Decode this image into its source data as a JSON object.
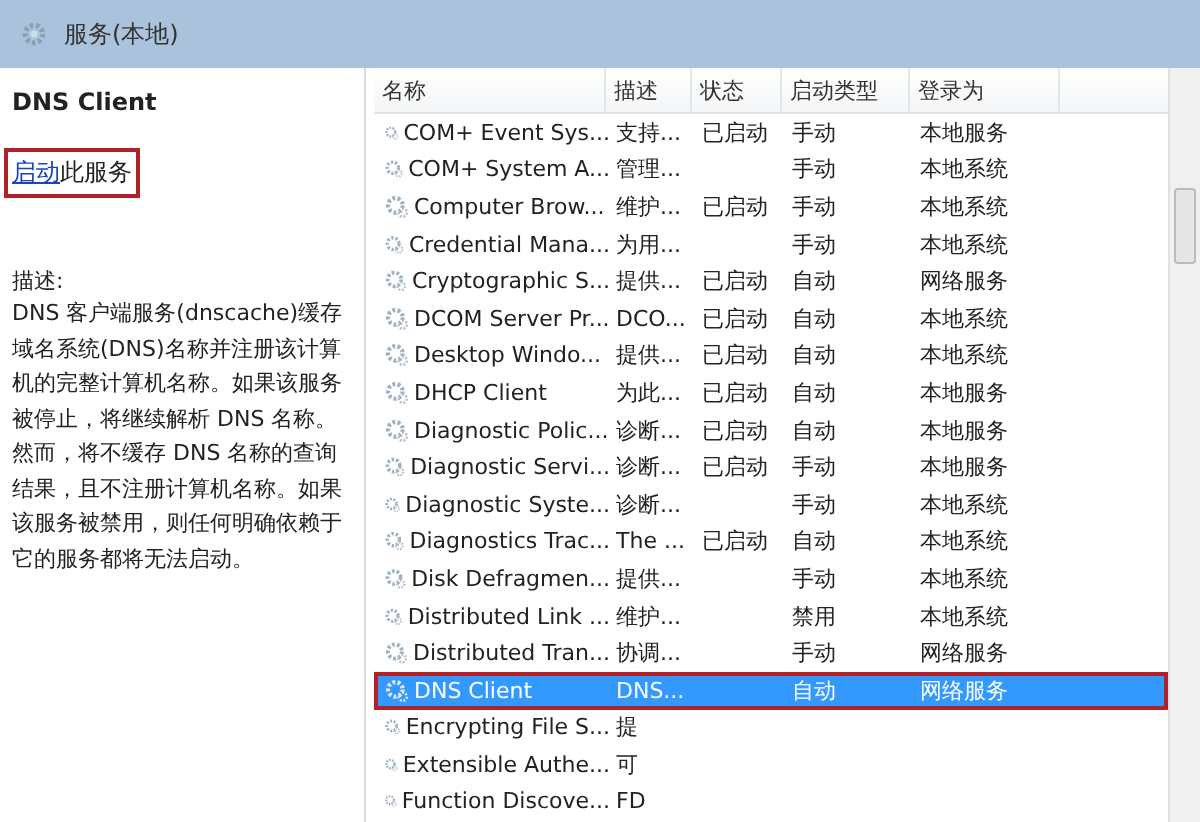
{
  "window": {
    "title": "服务(本地)"
  },
  "detail": {
    "service_name": "DNS Client",
    "action_link": "启动",
    "action_rest": "此服务",
    "action_outlined": true,
    "description_label": "描述:",
    "description": "DNS 客户端服务(dnscache)缓存域名系统(DNS)名称并注册该计算机的完整计算机名称。如果该服务被停止，将继续解析 DNS 名称。然而，将不缓存 DNS 名称的查询结果，且不注册计算机名称。如果该服务被禁用，则任何明确依赖于它的服务都将无法启动。"
  },
  "table": {
    "columns": [
      "名称",
      "描述",
      "状态",
      "启动类型",
      "登录为"
    ],
    "rows": [
      {
        "name": "COM+ Event Sys...",
        "description": "支持...",
        "status": "已启动",
        "startup": "手动",
        "logon": "本地服务",
        "selected": false,
        "outlined": false
      },
      {
        "name": "COM+ System A...",
        "description": "管理...",
        "status": "",
        "startup": "手动",
        "logon": "本地系统",
        "selected": false,
        "outlined": false
      },
      {
        "name": "Computer Brow...",
        "description": "维护...",
        "status": "已启动",
        "startup": "手动",
        "logon": "本地系统",
        "selected": false,
        "outlined": false
      },
      {
        "name": "Credential Mana...",
        "description": "为用...",
        "status": "",
        "startup": "手动",
        "logon": "本地系统",
        "selected": false,
        "outlined": false
      },
      {
        "name": "Cryptographic S...",
        "description": "提供...",
        "status": "已启动",
        "startup": "自动",
        "logon": "网络服务",
        "selected": false,
        "outlined": false
      },
      {
        "name": "DCOM Server Pr...",
        "description": "DCO...",
        "status": "已启动",
        "startup": "自动",
        "logon": "本地系统",
        "selected": false,
        "outlined": false
      },
      {
        "name": "Desktop Windo...",
        "description": "提供...",
        "status": "已启动",
        "startup": "自动",
        "logon": "本地系统",
        "selected": false,
        "outlined": false
      },
      {
        "name": "DHCP Client",
        "description": "为此...",
        "status": "已启动",
        "startup": "自动",
        "logon": "本地服务",
        "selected": false,
        "outlined": false
      },
      {
        "name": "Diagnostic Polic...",
        "description": "诊断...",
        "status": "已启动",
        "startup": "自动",
        "logon": "本地服务",
        "selected": false,
        "outlined": false
      },
      {
        "name": "Diagnostic Servi...",
        "description": "诊断...",
        "status": "已启动",
        "startup": "手动",
        "logon": "本地服务",
        "selected": false,
        "outlined": false
      },
      {
        "name": "Diagnostic Syste...",
        "description": "诊断...",
        "status": "",
        "startup": "手动",
        "logon": "本地系统",
        "selected": false,
        "outlined": false
      },
      {
        "name": "Diagnostics Trac...",
        "description": "The ...",
        "status": "已启动",
        "startup": "自动",
        "logon": "本地系统",
        "selected": false,
        "outlined": false
      },
      {
        "name": "Disk Defragmen...",
        "description": "提供...",
        "status": "",
        "startup": "手动",
        "logon": "本地系统",
        "selected": false,
        "outlined": false
      },
      {
        "name": "Distributed Link ...",
        "description": "维护...",
        "status": "",
        "startup": "禁用",
        "logon": "本地系统",
        "selected": false,
        "outlined": false
      },
      {
        "name": "Distributed Tran...",
        "description": "协调...",
        "status": "",
        "startup": "手动",
        "logon": "网络服务",
        "selected": false,
        "outlined": false
      },
      {
        "name": "DNS Client",
        "description": "DNS...",
        "status": "",
        "startup": "自动",
        "logon": "网络服务",
        "selected": true,
        "outlined": true
      },
      {
        "name": "Encrypting File S...",
        "description": "提",
        "status": "",
        "startup": "",
        "logon": "",
        "selected": false,
        "outlined": false
      },
      {
        "name": "Extensible Authe...",
        "description": "可",
        "status": "",
        "startup": "",
        "logon": "",
        "selected": false,
        "outlined": false
      },
      {
        "name": "Function Discove...",
        "description": "FD",
        "status": "",
        "startup": "",
        "logon": "",
        "selected": false,
        "outlined": false
      }
    ]
  }
}
